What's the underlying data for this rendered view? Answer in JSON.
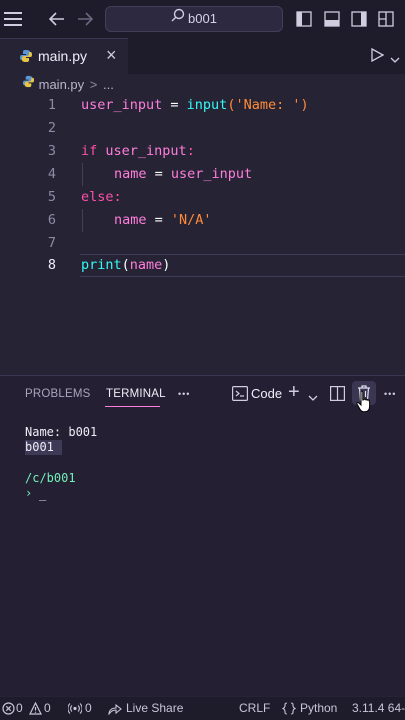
{
  "titlebar": {
    "menu_icon": "hamburger-icon",
    "search_text": "b001"
  },
  "tab": {
    "label": "main.py",
    "close": "×"
  },
  "breadcrumb": {
    "file": "main.py",
    "sep": ">",
    "more": "..."
  },
  "editor": {
    "line_numbers": [
      "1",
      "2",
      "3",
      "4",
      "5",
      "6",
      "7",
      "8"
    ],
    "current_line": "8",
    "lines": [
      {
        "t1": "user_input",
        "t2": " = ",
        "t3": "input",
        "t4": "(",
        "t5": "'Name: '",
        "t6": ")"
      },
      {},
      {
        "t1": "if",
        "t2": " ",
        "t3": "user_input",
        "t4": ":"
      },
      {
        "t1": "name",
        "t2": " = ",
        "t3": "user_input"
      },
      {
        "t1": "else",
        "t2": ":"
      },
      {
        "t1": "name",
        "t2": " = ",
        "t3": "'N/A'"
      },
      {},
      {
        "t1": "print",
        "t2": "(",
        "t3": "name",
        "t4": ")"
      }
    ]
  },
  "panel": {
    "tab_problems": "PROBLEMS",
    "tab_terminal": "TERMINAL",
    "more": "•••",
    "terminal_name": "Code",
    "add": "+",
    "more_right": "•••"
  },
  "terminal": {
    "line1": "Name: b001",
    "line2": "b001",
    "line3": "/c/b001",
    "prompt": "›",
    "cursor": "_"
  },
  "statusbar": {
    "errors": "0",
    "warnings": "0",
    "ports": "0",
    "live_share": "Live Share",
    "eol": "CRLF",
    "language": "Python",
    "version": "3.11.4 64-"
  }
}
